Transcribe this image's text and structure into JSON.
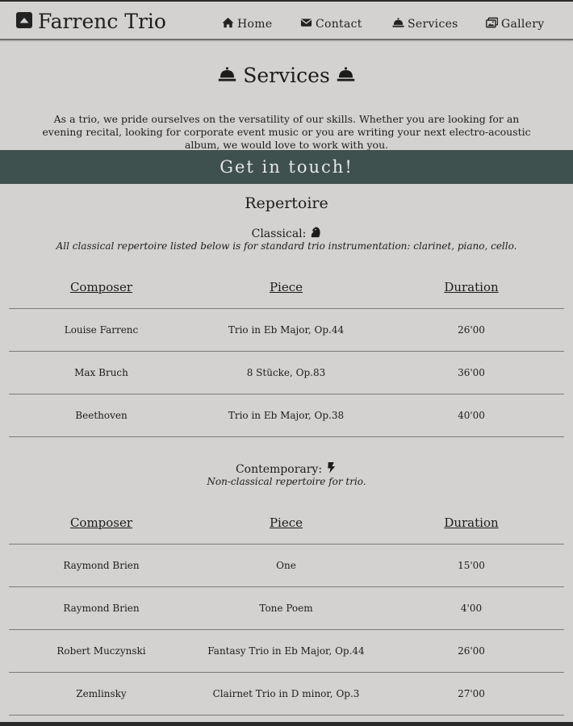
{
  "header": {
    "brand": "Farrenc Trio",
    "nav": [
      {
        "label": "Home",
        "icon": "home-icon"
      },
      {
        "label": "Contact",
        "icon": "envelope-icon"
      },
      {
        "label": "Services",
        "icon": "service-bell-icon"
      },
      {
        "label": "Gallery",
        "icon": "images-icon"
      }
    ]
  },
  "main": {
    "title": "Services",
    "intro": "As a trio, we pride ourselves on the versatility of our skills. Whether you are looking for an evening recital, looking for corporate event music or you are writing your next electro-acoustic album, we would love to work with you.",
    "cta": "Get in touch!",
    "repertoire_title": "Repertoire"
  },
  "classical": {
    "title": "Classical:",
    "description": "All classical repertoire listed below is for standard trio instrumentation: clarinet, piano, cello.",
    "headers": [
      "Composer",
      "Piece",
      "Duration"
    ],
    "rows": [
      [
        "Louise Farrenc",
        "Trio in Eb Major, Op.44",
        "26'00"
      ],
      [
        "Max Bruch",
        "8 Stücke, Op.83",
        "36'00"
      ],
      [
        "Beethoven",
        "Trio in Eb Major, Op.38",
        "40'00"
      ]
    ]
  },
  "contemporary": {
    "title": "Contemporary:",
    "description": "Non-classical repertoire for trio.",
    "headers": [
      "Composer",
      "Piece",
      "Duration"
    ],
    "rows": [
      [
        "Raymond Brien",
        "One",
        "15'00"
      ],
      [
        "Raymond Brien",
        "Tone Poem",
        "4'00"
      ],
      [
        "Robert Muczynski",
        "Fantasy Trio in Eb Major, Op.44",
        "26'00"
      ],
      [
        "Zemlinsky",
        "Clairnet Trio in D minor, Op.3",
        "27'00"
      ]
    ]
  },
  "colors": {
    "background": "#d3d2d0",
    "cta_band": "#3e514e",
    "text": "#1c1c1c"
  }
}
